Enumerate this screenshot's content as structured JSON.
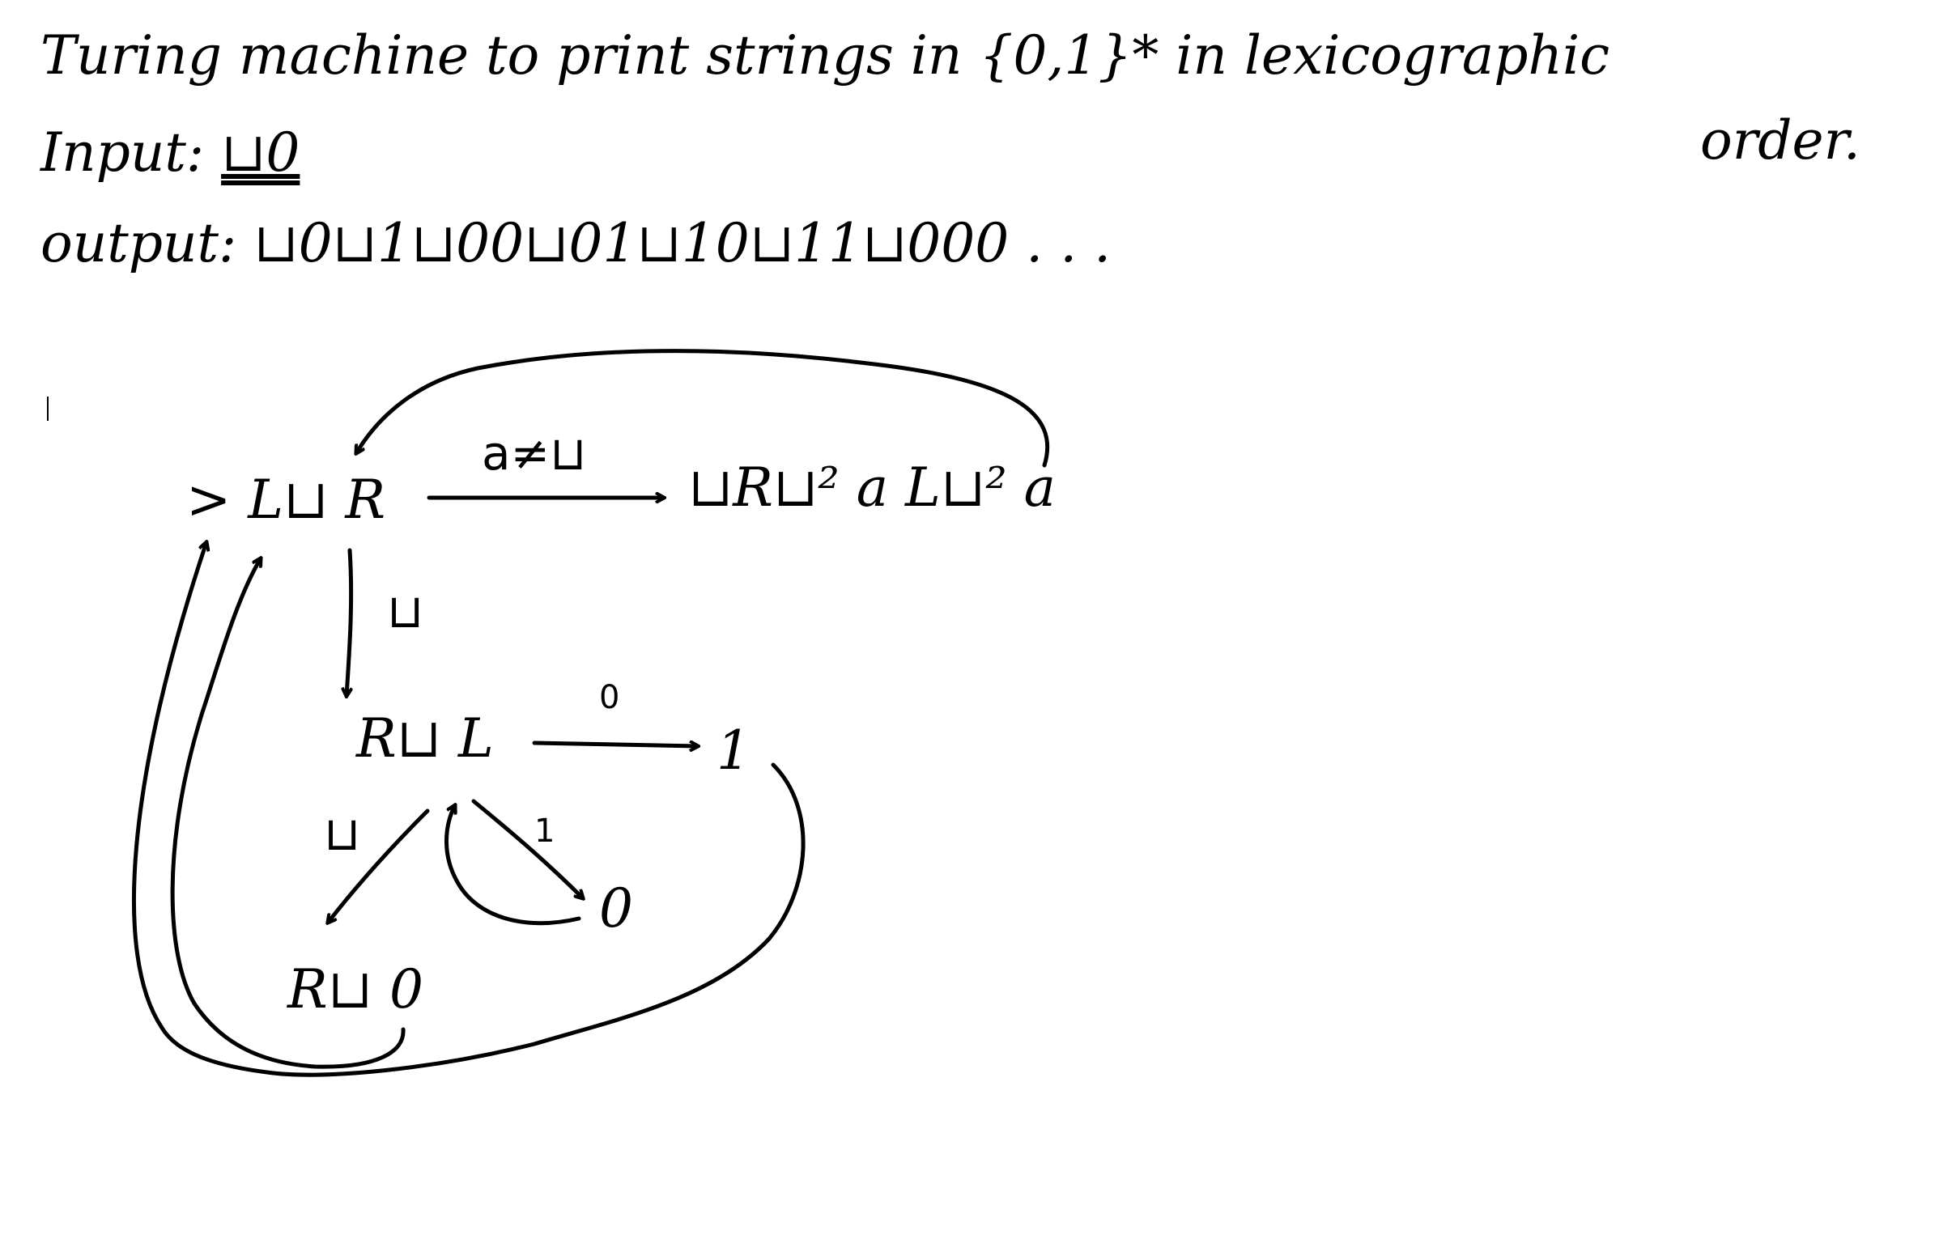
{
  "header": {
    "title": "Turing machine to print strings in {0,1}* in lexicographic",
    "title_cont": "order.",
    "input_label": "Input:",
    "input_value": "⊔0",
    "output_label": "output:",
    "output_value": "⊔0⊔1⊔00⊔01⊔10⊔11⊔000 . . ."
  },
  "diagram": {
    "nodes": {
      "start": "> L⊔ R",
      "write": "⊔R⊔² a L⊔² a",
      "right_left": "R⊔ L",
      "one": "1",
      "zero": "0",
      "bottom": "R⊔ 0"
    },
    "edge_labels": {
      "start_to_write": "a≠⊔",
      "start_to_right_left": "⊔",
      "right_left_to_one": "0",
      "right_left_to_bottom": "⊔",
      "right_left_to_zero": "1"
    }
  }
}
